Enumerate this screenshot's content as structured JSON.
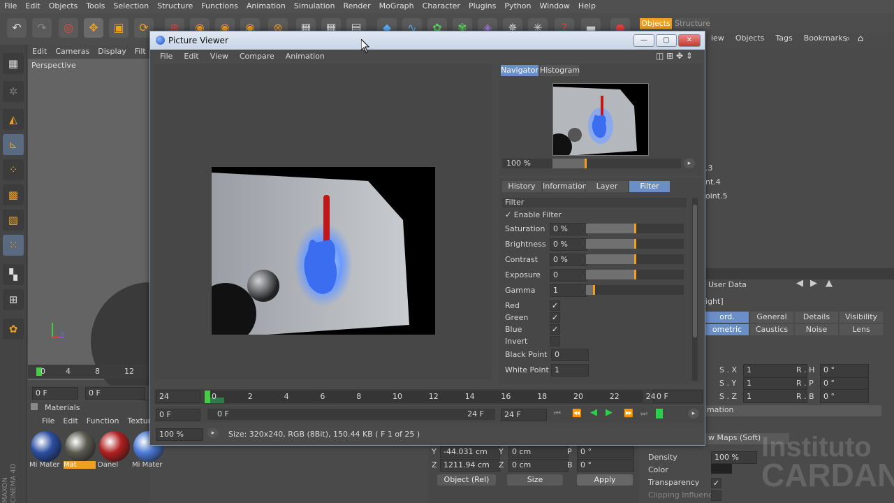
{
  "menubar": [
    "File",
    "Edit",
    "Objects",
    "Tools",
    "Selection",
    "Structure",
    "Functions",
    "Animation",
    "Simulation",
    "Render",
    "MoGraph",
    "Character",
    "Plugins",
    "Python",
    "Window",
    "Help"
  ],
  "topright": {
    "objects_tab": "Objects",
    "structure_tab": "Structure"
  },
  "viewport": {
    "menu": [
      "Edit",
      "Cameras",
      "Display",
      "Filt"
    ],
    "label": "Perspective",
    "ruler": [
      "0",
      "4",
      "8",
      "12"
    ],
    "frame_a": "0 F",
    "frame_b": "0 F"
  },
  "materials": {
    "title": "Materials",
    "menu": [
      "File",
      "Edit",
      "Function",
      "Textur"
    ],
    "items": [
      {
        "name": "Mi Mater",
        "color": "#2a4ea0"
      },
      {
        "name": "Mat",
        "color": "#5a5a50"
      },
      {
        "name": "Danel",
        "color": "#b02020"
      },
      {
        "name": "Mi Mater",
        "color": "#4a7ad8"
      }
    ]
  },
  "object_manager": {
    "menu": [
      "iew",
      "Objects",
      "Tags",
      "Bookmarks"
    ],
    "rows": [
      ".3",
      "nt.4",
      "oint.5"
    ]
  },
  "attributes": {
    "title": "User Data",
    "tabs_row1": [
      "ord.",
      "General",
      "Details",
      "Visibility"
    ],
    "tabs_row2": [
      "ometric",
      "Caustics",
      "Noise",
      "Lens"
    ],
    "light": "ight]",
    "size": [
      {
        "label": "S . X",
        "value": "1"
      },
      {
        "label": "S . Y",
        "value": "1"
      },
      {
        "label": "S . Z",
        "value": "1"
      }
    ],
    "rot": [
      {
        "label": "R . H",
        "value": "0 °"
      },
      {
        "label": "R . P",
        "value": "0 °"
      },
      {
        "label": "R . B",
        "value": "0 °"
      }
    ],
    "section": "mation",
    "shadow": "w Maps (Soft)",
    "density_label": "Density",
    "density": "100 %",
    "color_label": "Color",
    "transparency_label": "Transparency",
    "clipping_label": "Clipping Influence"
  },
  "coords": {
    "y_label": "Y",
    "y_val": "-44.031 cm",
    "z_label": "Z",
    "z_val": "1211.94 cm",
    "y2": "0 cm",
    "z2": "0 cm",
    "p": "0 °",
    "b": "0 °",
    "y2_label": "Y",
    "z2_label": "Z",
    "p_label": "P",
    "b_label": "B",
    "mode": "Object (Rel)",
    "size": "Size",
    "apply": "Apply"
  },
  "pv": {
    "title": "Picture Viewer",
    "menu": [
      "File",
      "Edit",
      "View",
      "Compare",
      "Animation"
    ],
    "nav_tabs": [
      "Navigator",
      "Histogram"
    ],
    "zoom": "100 %",
    "tabs": [
      "History",
      "Information",
      "Layer",
      "Filter"
    ],
    "filter_section": "Filter",
    "enable_filter": "Enable Filter",
    "sliders": [
      {
        "label": "Saturation",
        "value": "0 %",
        "pos": 0.5
      },
      {
        "label": "Brightness",
        "value": "0 %",
        "pos": 0.5
      },
      {
        "label": "Contrast",
        "value": "0 %",
        "pos": 0.5
      },
      {
        "label": "Exposure",
        "value": "0",
        "pos": 0.5
      },
      {
        "label": "Gamma",
        "value": "1",
        "pos": 0.08
      }
    ],
    "checks": [
      {
        "label": "Red",
        "value": "✓"
      },
      {
        "label": "Green",
        "value": "✓"
      },
      {
        "label": "Blue",
        "value": "✓"
      },
      {
        "label": "Invert",
        "value": ""
      }
    ],
    "points": [
      {
        "label": "Black Point",
        "value": "0"
      },
      {
        "label": "White Point",
        "value": "1"
      }
    ],
    "timeline_ticks": [
      "0",
      "2",
      "4",
      "6",
      "8",
      "10",
      "12",
      "14",
      "16",
      "18",
      "20",
      "22",
      "24"
    ],
    "fps": "24",
    "frame_end": "0 F",
    "start": "0 F",
    "range_start": "0 F",
    "range_end": "24 F",
    "current": "24 F",
    "status_zoom": "100 %",
    "status": "Size: 320x240, RGB (8Bit), 150.44 KB ( F 1 of 25 )"
  },
  "watermark": [
    "Instituto",
    "CARDAN"
  ],
  "brand": [
    "MAXON",
    "CINEMA 4D"
  ]
}
